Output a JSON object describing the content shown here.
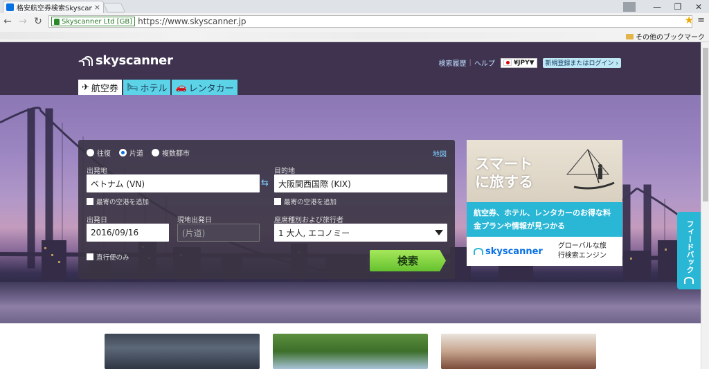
{
  "browser": {
    "tab_title": "格安航空券検索Skyscanner",
    "tab_close": "×",
    "window_controls": [
      "—",
      "❐",
      "✕"
    ],
    "ev_label": "Skyscanner Ltd [GB]",
    "url": "https://www.skyscanner.jp",
    "other_bookmarks": "その他のブックマーク"
  },
  "header": {
    "logo_text": "skyscanner",
    "history": "検索履歴",
    "help": "ヘルプ",
    "currency": "¥JPY▼",
    "login": "新規登録またはログイン ›"
  },
  "tabs": [
    {
      "label": "航空券",
      "icon": "✈"
    },
    {
      "label": "ホテル",
      "icon": "🛏"
    },
    {
      "label": "レンタカー",
      "icon": "🚗"
    }
  ],
  "search": {
    "trip_types": [
      "往復",
      "片道",
      "複数都市"
    ],
    "selected_trip": "片道",
    "map_link": "地図",
    "from_label": "出発地",
    "from_value": "ベトナム (VN)",
    "to_label": "目的地",
    "to_value": "大阪関西国際 (KIX)",
    "nearby_from": "最寄の空港を追加",
    "nearby_to": "最寄の空港を追加",
    "depart_label": "出発日",
    "depart_value": "2016/09/16",
    "return_label": "現地出発日",
    "return_value": "(片道)",
    "cabin_label": "座席種別および旅行者",
    "cabin_value": "1 大人, エコノミー",
    "direct_only": "直行便のみ",
    "search_button": "検索"
  },
  "ad": {
    "headline_1": "スマート",
    "headline_2": "に旅する",
    "body": "航空券、ホテル、レンタカーのお得な料金プランや情報が見つかる",
    "logo": "skyscanner",
    "tagline_1": "グローバルな旅",
    "tagline_2": "行検索エンジン"
  },
  "feedback": {
    "label": "フィードバック"
  },
  "colors": {
    "header_bg": "#3f3350",
    "accent_cyan": "#2ab7d6",
    "search_green": "#7ed23e",
    "link_blue": "#7fd0ff"
  }
}
